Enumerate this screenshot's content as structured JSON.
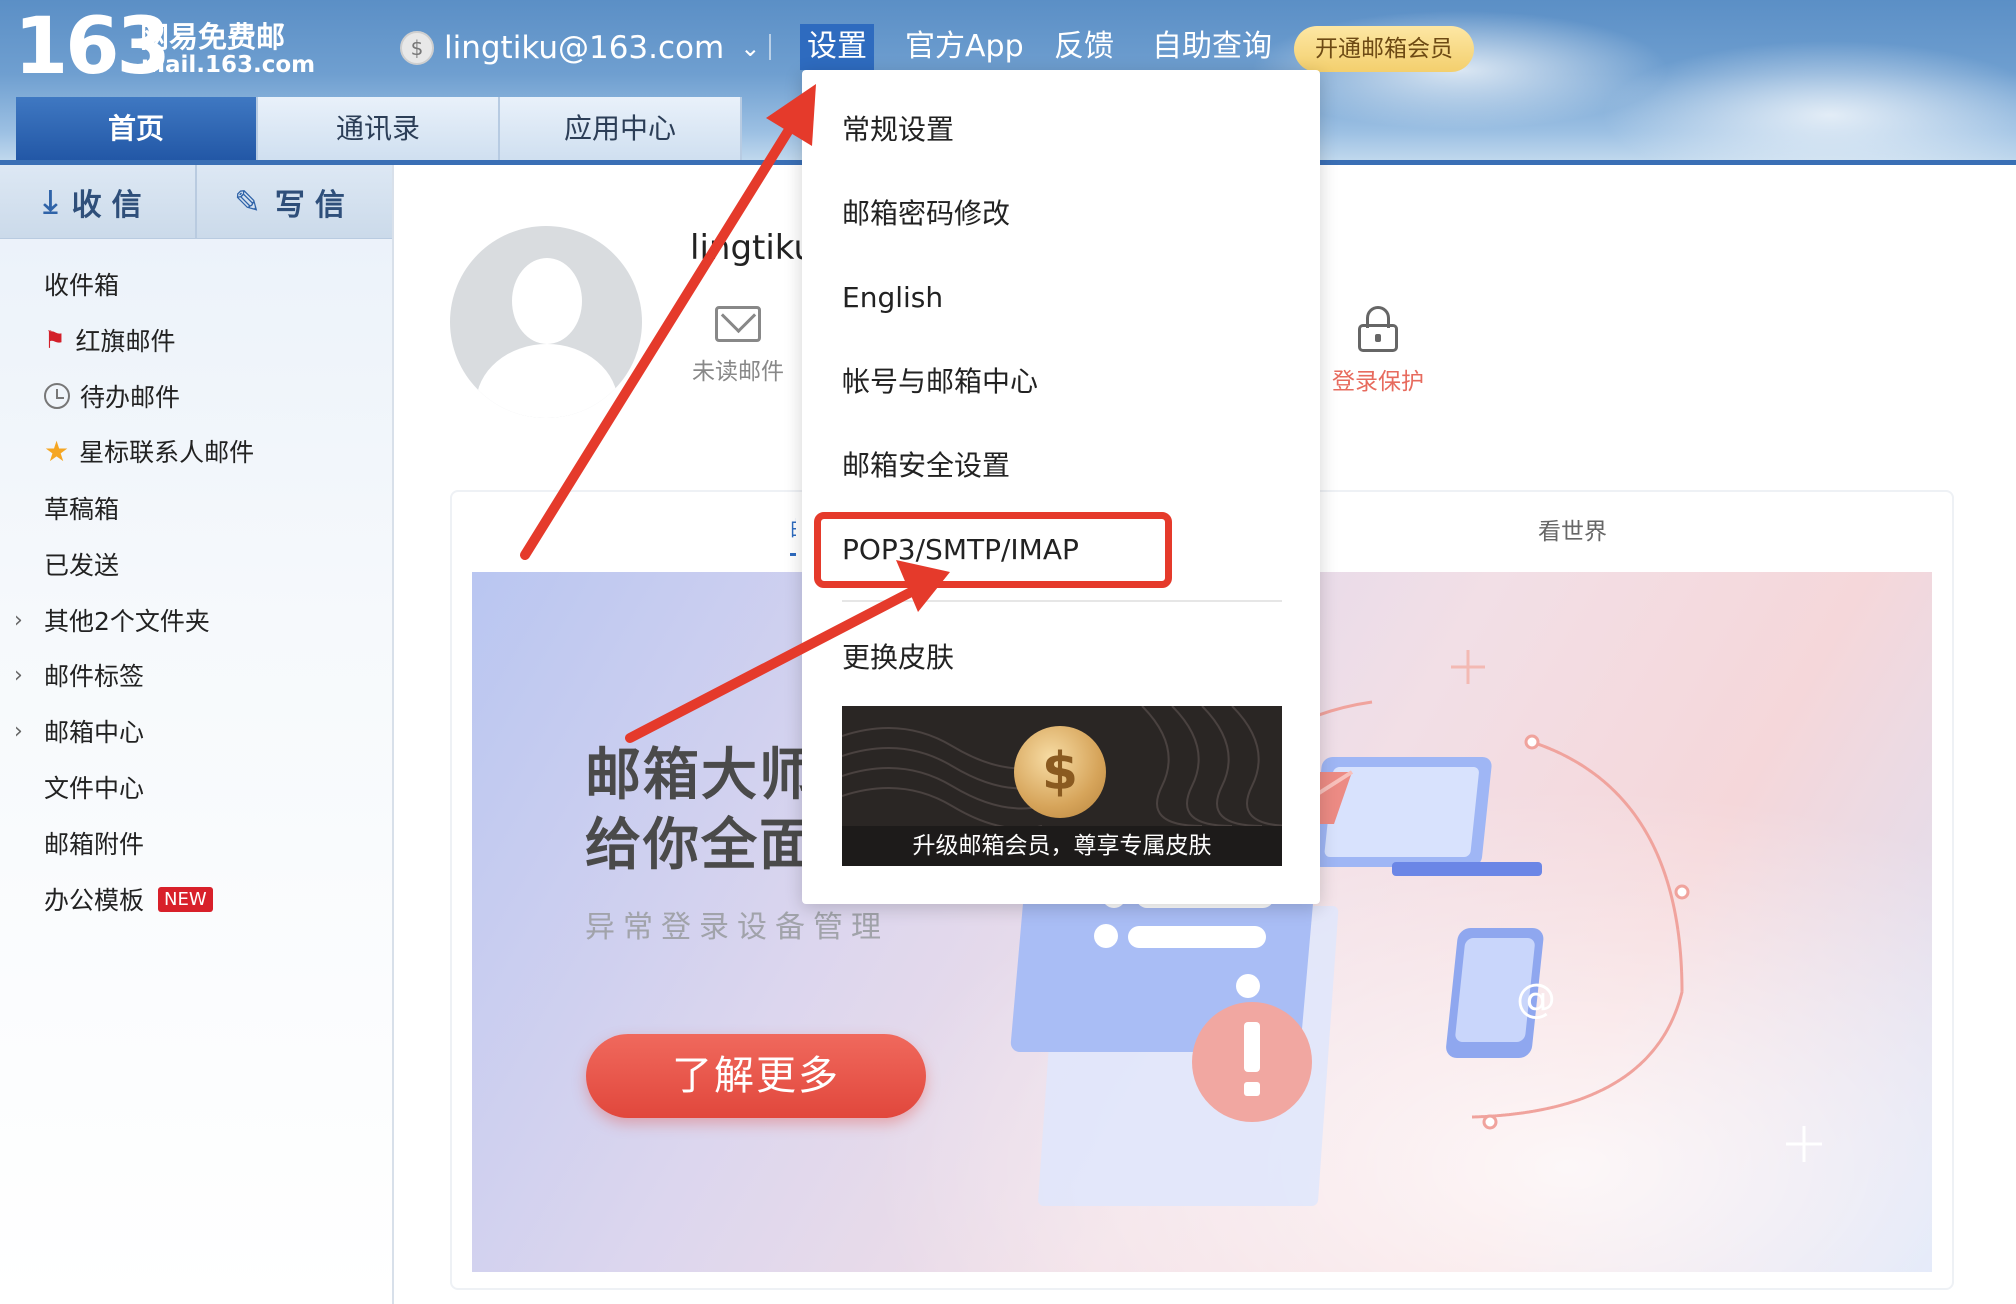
{
  "header": {
    "logo_number": "163",
    "logo_title": "网易免费邮",
    "logo_domain": "mail.163.com",
    "account_email": "lingtiku@163.com",
    "nav": {
      "settings": "设置",
      "app": "官方App",
      "feedback": "反馈",
      "self_query": "自助查询",
      "vip": "开通邮箱会员"
    },
    "tabs": [
      "首页",
      "通讯录",
      "应用中心"
    ]
  },
  "sidebar": {
    "receive_label": "收信",
    "compose_label": "写信",
    "folders": [
      {
        "label": "收件箱"
      },
      {
        "label": "红旗邮件"
      },
      {
        "label": "待办邮件"
      },
      {
        "label": "星标联系人邮件"
      },
      {
        "label": "草稿箱"
      },
      {
        "label": "已发送"
      },
      {
        "label": "其他2个文件夹"
      },
      {
        "label": "邮件标签"
      },
      {
        "label": "邮箱中心"
      },
      {
        "label": "文件中心"
      },
      {
        "label": "邮箱附件"
      },
      {
        "label": "办公模板",
        "badge": "NEW"
      }
    ]
  },
  "main": {
    "user_name": "lingtiku",
    "stats": {
      "unread": "未读邮件",
      "login_protect": "登录保护"
    },
    "panel_tabs": {
      "left": "邮",
      "world": "看世界"
    },
    "banner": {
      "title_line1": "邮箱大师",
      "title_line2": "给你全面",
      "subtitle": "异常登录设备管理",
      "button": "了解更多"
    }
  },
  "dropdown": {
    "items": [
      "常规设置",
      "邮箱密码修改",
      "English",
      "帐号与邮箱中心",
      "邮箱安全设置",
      "POP3/SMTP/IMAP",
      "更换皮肤"
    ],
    "skin_caption": "升级邮箱会员，尊享专属皮肤"
  },
  "colors": {
    "accent_blue": "#2e6bbf",
    "annotation_red": "#e53a2b",
    "vip_gold": "#f3cf6d"
  }
}
